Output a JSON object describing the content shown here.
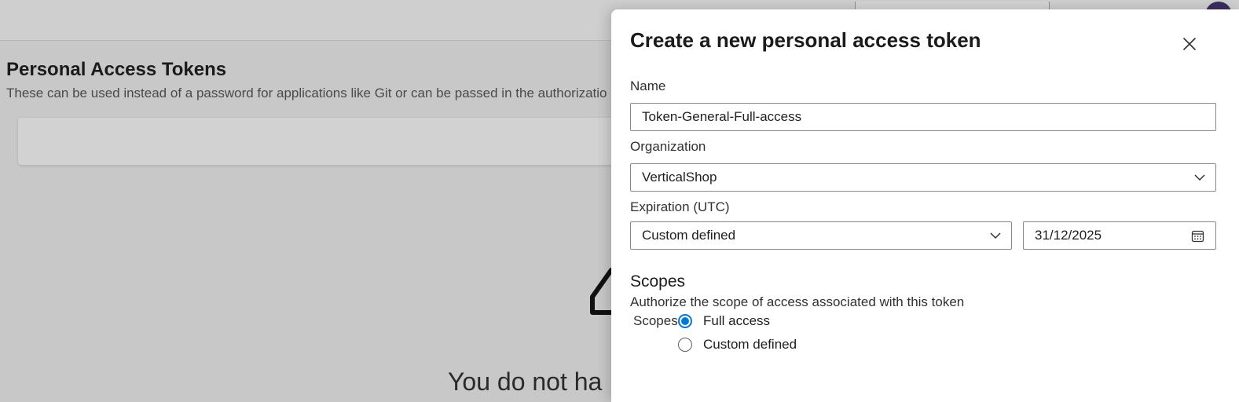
{
  "background": {
    "page_title": "Personal Access Tokens",
    "page_description": "These can be used instead of a password for applications like Git or can be passed in the authorizatio",
    "empty_state_text": "You do not ha"
  },
  "dialog": {
    "title": "Create a new personal access token",
    "close_icon": "close-icon",
    "name": {
      "label": "Name",
      "value": "Token-General-Full-access"
    },
    "organization": {
      "label": "Organization",
      "value": "VerticalShop"
    },
    "expiration": {
      "label": "Expiration (UTC)",
      "value": "Custom defined",
      "date": "31/12/2025"
    },
    "scopes": {
      "title": "Scopes",
      "description": "Authorize the scope of access associated with this token",
      "group_label": "Scopes",
      "options": [
        {
          "label": "Full access",
          "selected": true
        },
        {
          "label": "Custom defined",
          "selected": false
        }
      ]
    }
  },
  "colors": {
    "accent": "#0078d4",
    "overlay": "#c8c8c8",
    "avatar": "#3b2d5e"
  }
}
